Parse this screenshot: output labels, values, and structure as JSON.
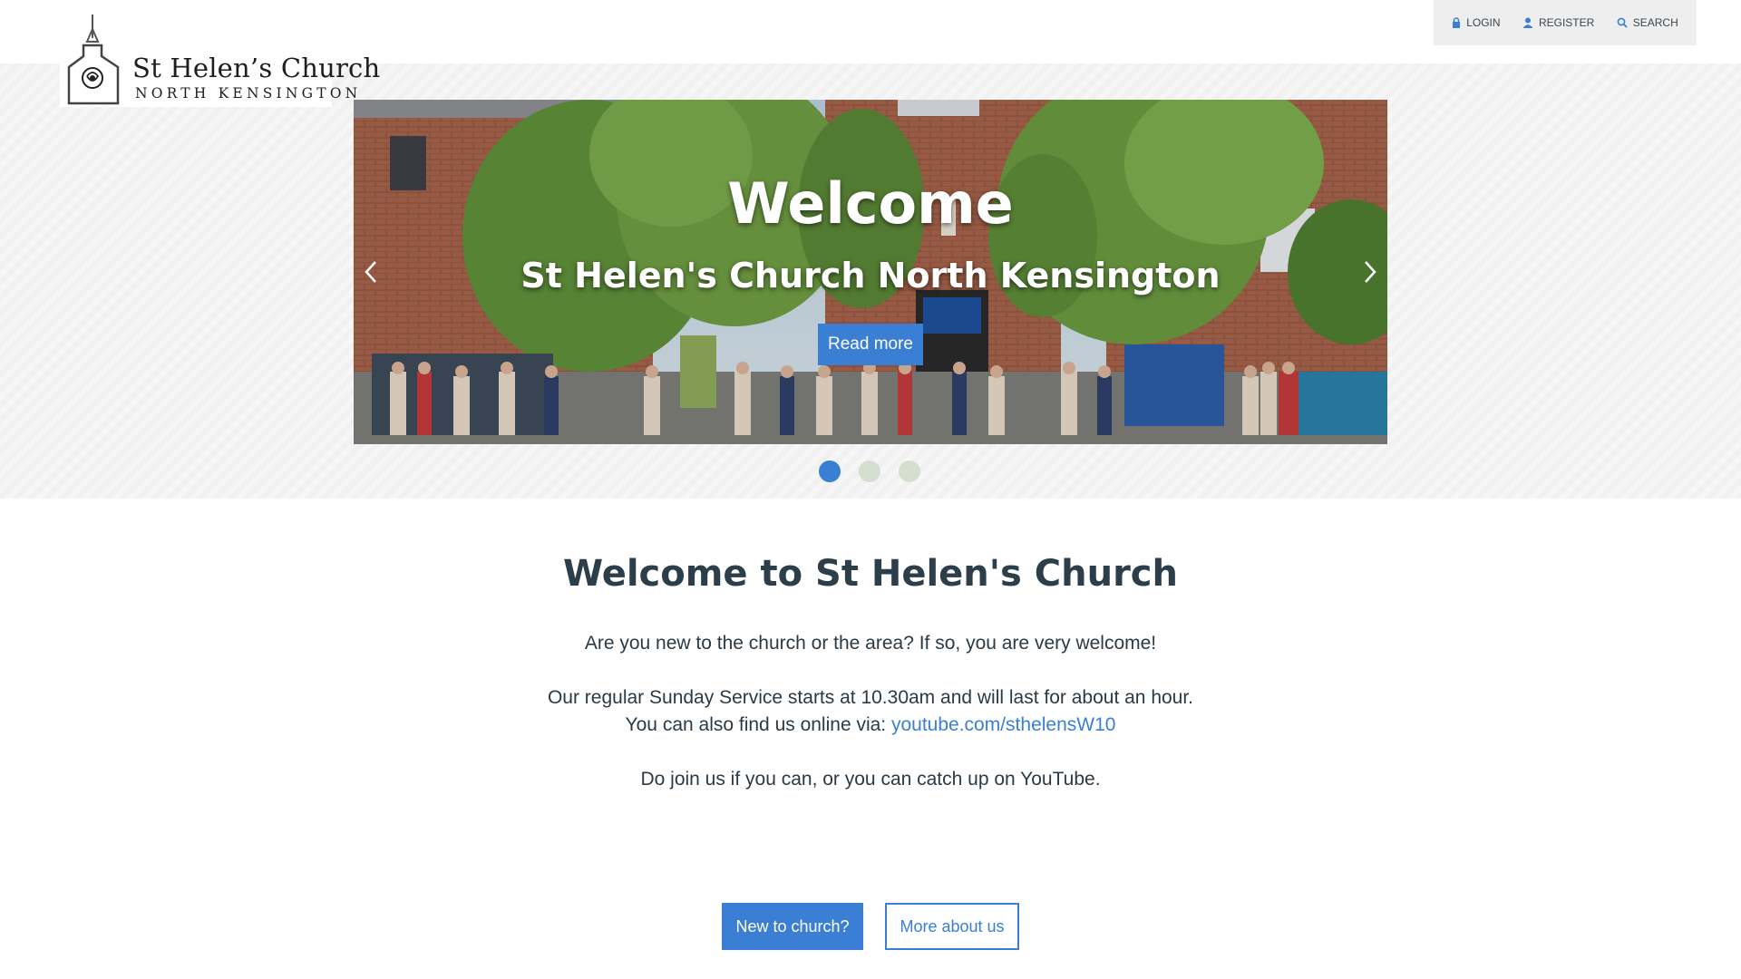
{
  "logo": {
    "title": "St Helen’s Church",
    "subtitle": "NORTH KENSINGTON",
    "icon": "church-logo-icon"
  },
  "topnav": {
    "items": [
      {
        "label": "LOGIN",
        "icon": "lock-icon"
      },
      {
        "label": "REGISTER",
        "icon": "user-icon"
      },
      {
        "label": "SEARCH",
        "icon": "search-icon"
      }
    ]
  },
  "slider": {
    "title": "Welcome",
    "subtitle": "St Helen's Church North Kensington",
    "button_label": "Read more",
    "prev_icon": "chevron-left-icon",
    "next_icon": "chevron-right-icon",
    "slide_count": 3,
    "active_slide": 1
  },
  "welcome": {
    "heading": "Welcome to St Helen's Church",
    "p1": "Are you new to the church or the area? If so, you are very welcome!",
    "p2": "Our regular Sunday Service starts at 10.30am and will last for about an hour.",
    "p3_prefix": "You can also find us online via: ",
    "p3_link": "youtube.com/sthelensW10",
    "p4": "Do join us if you can, or you can catch up on YouTube."
  },
  "buttons": {
    "new_to_church": "New to church?",
    "more_about_us": "More about us"
  },
  "colors": {
    "accent": "#3b7fd4",
    "heading": "#2b3e4a",
    "dot_inactive": "#d4dfd0"
  }
}
